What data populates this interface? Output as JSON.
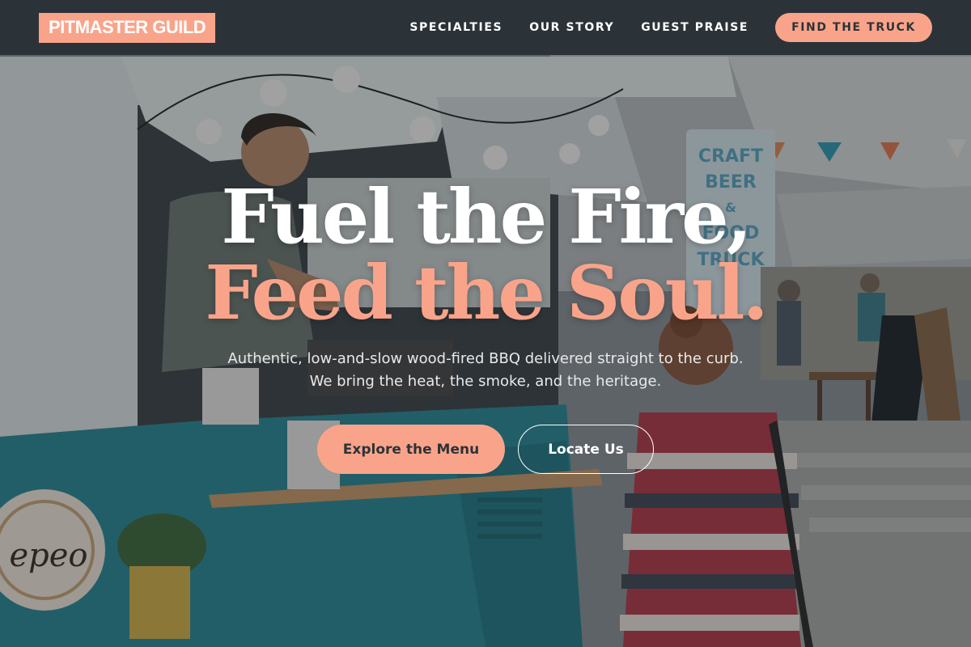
{
  "nav": {
    "logo": "PITMASTER GUILD",
    "links": [
      "SPECIALTIES",
      "OUR STORY",
      "GUEST PRAISE"
    ],
    "cta": "FIND THE TRUCK"
  },
  "hero": {
    "headline_line1": "Fuel the Fire,",
    "headline_line2": "Feed the Soul.",
    "subtext_line1": "Authentic, low-and-slow wood-fired BBQ delivered straight to the curb.",
    "subtext_line2": "We bring the heat, the smoke, and the heritage.",
    "primary_button": "Explore the Menu",
    "secondary_button": "Locate Us",
    "background_photo": "food-truck-vendor-serving-customer",
    "photo_sign_text": "CRAFT BEER & FOOD TRUCK",
    "truck_logo_text": "Repeo"
  },
  "colors": {
    "accent": "#f9a48a",
    "nav_background": "#2c3338",
    "headline_white": "#ffffff",
    "truck_teal": "#2a8a96"
  }
}
